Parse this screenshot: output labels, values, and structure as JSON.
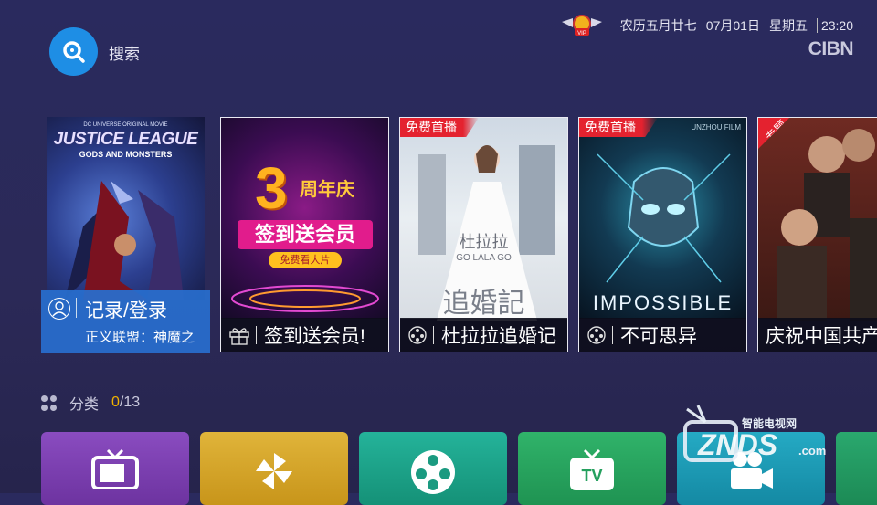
{
  "header": {
    "search_label": "搜索",
    "lunar_date": "农历五月廿七",
    "date": "07月01日",
    "weekday": "星期五",
    "time": "23:20",
    "brand": "CIBN"
  },
  "login": {
    "title": "记录/登录",
    "subtitle": "正义联盟：神魔之"
  },
  "cards": [
    {
      "title": "签到送会员!",
      "icon": "gift-icon"
    },
    {
      "title": "杜拉拉追婚记",
      "icon": "film-reel-icon",
      "badge": "免费首播"
    },
    {
      "title": "不可思异",
      "icon": "film-reel-icon",
      "badge": "免费首播"
    },
    {
      "title": "庆祝中国共产",
      "badge": "专题"
    }
  ],
  "posters": {
    "jl_top": "DC UNIVERSE ORIGINAL MOVIE",
    "jl_title": "JUSTICE LEAGUE",
    "jl_sub": "GODS AND MONSTERS",
    "anniv_num": "3",
    "anniv_word": "周年庆",
    "anniv_main": "签到送会员",
    "anniv_sub": "免费看大片",
    "lala_cn": "杜拉拉",
    "lala_en": "GO LALA GO",
    "lala_title": "追婚記",
    "imp_title": "IMPOSSIBLE",
    "imp_studio": "UNZHOU FILM"
  },
  "category": {
    "label": "分类",
    "current": "0",
    "total": "/13"
  },
  "tiles": [
    {
      "color": "#7c3fb0",
      "icon": "tv-icon"
    },
    {
      "color": "#d4a020",
      "icon": "pinwheel-icon"
    },
    {
      "color": "#1fa890",
      "icon": "film-reel-icon"
    },
    {
      "color": "#2aa860",
      "icon": "tv-box-icon",
      "text": "TV"
    },
    {
      "color": "#1aa0b8",
      "icon": "camera-icon"
    }
  ],
  "watermark": {
    "line1": "智能电视网",
    "line2": "ZNDS",
    "line3": ".com"
  }
}
